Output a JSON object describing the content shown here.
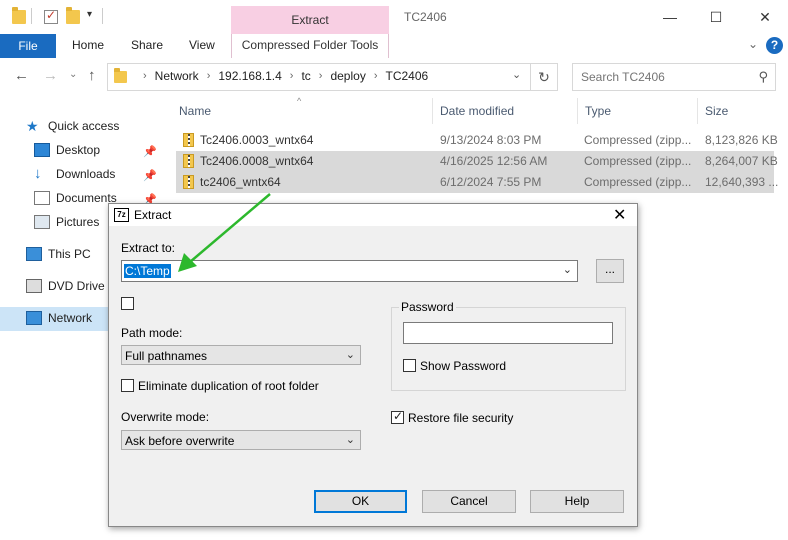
{
  "window": {
    "title": "TC2406",
    "context_tab": "Extract",
    "minimize": "—",
    "maximize": "☐",
    "close": "✕"
  },
  "ribbon": {
    "file": "File",
    "home": "Home",
    "share": "Share",
    "view": "View",
    "compressed_tools": "Compressed Folder Tools",
    "help": "?"
  },
  "address": {
    "crumbs": [
      "Network",
      "192.168.1.4",
      "tc",
      "deploy",
      "TC2406"
    ],
    "search_placeholder": "Search TC2406"
  },
  "sidebar": {
    "items": [
      {
        "label": "Quick access",
        "icon": "star-icon"
      },
      {
        "label": "Desktop",
        "icon": "desktop-icon"
      },
      {
        "label": "Downloads",
        "icon": "download-icon"
      },
      {
        "label": "Documents",
        "icon": "documents-icon"
      },
      {
        "label": "Pictures",
        "icon": "pictures-icon"
      },
      {
        "label": "This PC",
        "icon": "pc-icon"
      },
      {
        "label": "DVD Drive (",
        "icon": "dvd-icon"
      },
      {
        "label": "Network",
        "icon": "network-icon"
      }
    ]
  },
  "filelist": {
    "columns": [
      "Name",
      "Date modified",
      "Type",
      "Size"
    ],
    "rows": [
      {
        "name": "Tc2406.0003_wntx64",
        "date": "9/13/2024 8:03 PM",
        "type": "Compressed (zipp...",
        "size": "8,123,826 KB"
      },
      {
        "name": "Tc2406.0008_wntx64",
        "date": "4/16/2025 12:56 AM",
        "type": "Compressed (zipp...",
        "size": "8,264,007 KB"
      },
      {
        "name": "tc2406_wntx64",
        "date": "6/12/2024 7:55 PM",
        "type": "Compressed (zipp...",
        "size": "12,640,393 ..."
      }
    ]
  },
  "dialog": {
    "icon_text": "7z",
    "title": "Extract",
    "extract_to_label": "Extract to:",
    "extract_to_value": "C:\\Temp",
    "browse_label": "...",
    "path_mode_label": "Path mode:",
    "path_mode_value": "Full pathnames",
    "eliminate_label": "Eliminate duplication of root folder",
    "overwrite_label": "Overwrite mode:",
    "overwrite_value": "Ask before overwrite",
    "password_label": "Password",
    "show_password_label": "Show Password",
    "restore_security_label": "Restore file security",
    "ok": "OK",
    "cancel": "Cancel",
    "help": "Help",
    "colors": {
      "highlight": "#0078d7",
      "arrow": "#2db82d"
    }
  }
}
